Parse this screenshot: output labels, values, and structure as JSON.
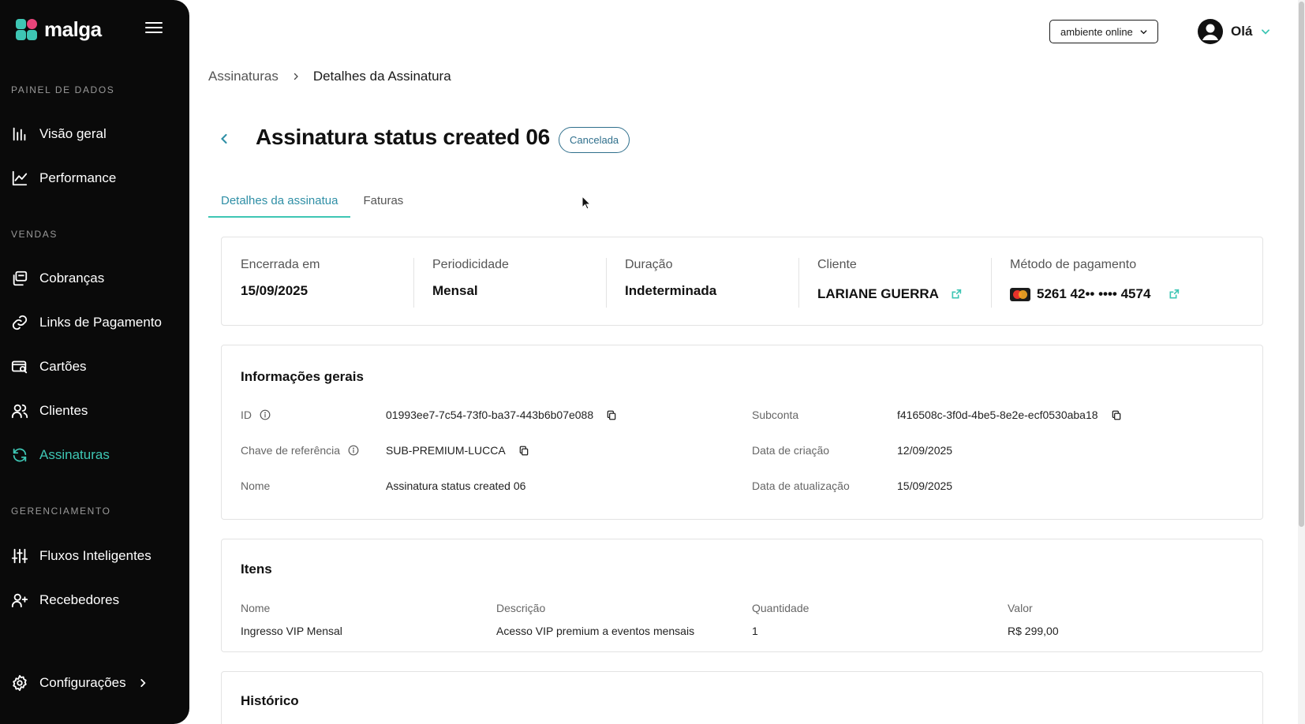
{
  "app": {
    "logo_text": "malga"
  },
  "sidebar": {
    "sections": {
      "dados": "PAINEL DE DADOS",
      "vendas": "VENDAS",
      "gerenciamento": "GERENCIAMENTO"
    },
    "items": {
      "visao_geral": {
        "label": "Visão geral",
        "icon": "bar-chart-icon"
      },
      "performance": {
        "label": "Performance",
        "icon": "line-chart-icon"
      },
      "cobrancas": {
        "label": "Cobranças",
        "icon": "charges-icon"
      },
      "links": {
        "label": "Links de Pagamento",
        "icon": "link-icon"
      },
      "cartoes": {
        "label": "Cartões",
        "icon": "card-search-icon"
      },
      "clientes": {
        "label": "Clientes",
        "icon": "users-icon"
      },
      "assinaturas": {
        "label": "Assinaturas",
        "icon": "refresh-icon",
        "active": true
      },
      "fluxos": {
        "label": "Fluxos Inteligentes",
        "icon": "sliders-icon"
      },
      "recebedores": {
        "label": "Recebedores",
        "icon": "user-plus-icon"
      },
      "configuracoes": {
        "label": "Configurações",
        "icon": "gear-icon"
      }
    }
  },
  "topbar": {
    "environment": "ambiente online",
    "greeting": "Olá"
  },
  "breadcrumb": {
    "parent": "Assinaturas",
    "current": "Detalhes da Assinatura"
  },
  "page": {
    "title": "Assinatura status created 06",
    "status": "Cancelada"
  },
  "tabs": {
    "details": "Detalhes da assinatua",
    "invoices": "Faturas"
  },
  "summary": {
    "ended": {
      "label": "Encerrada em",
      "value": "15/09/2025"
    },
    "period": {
      "label": "Periodicidade",
      "value": "Mensal"
    },
    "duration": {
      "label": "Duração",
      "value": "Indeterminada"
    },
    "customer": {
      "label": "Cliente",
      "value": "LARIANE GUERRA"
    },
    "payment": {
      "label": "Método de pagamento",
      "value": "5261 42•• •••• 4574"
    }
  },
  "info": {
    "title": "Informações gerais",
    "id": {
      "label": "ID",
      "value": "01993ee7-7c54-73f0-ba37-443b6b07e088"
    },
    "reference": {
      "label": "Chave de referência",
      "value": "SUB-PREMIUM-LUCCA"
    },
    "name": {
      "label": "Nome",
      "value": "Assinatura status created 06"
    },
    "subaccount": {
      "label": "Subconta",
      "value": "f416508c-3f0d-4be5-8e2e-ecf0530aba18"
    },
    "created": {
      "label": "Data de criação",
      "value": "12/09/2025"
    },
    "updated": {
      "label": "Data de atualização",
      "value": "15/09/2025"
    }
  },
  "items": {
    "title": "Itens",
    "headers": {
      "name": "Nome",
      "description": "Descrição",
      "quantity": "Quantidade",
      "value": "Valor"
    },
    "rows": [
      {
        "name": "Ingresso VIP Mensal",
        "description": "Acesso VIP premium a eventos mensais",
        "quantity": "1",
        "value": "R$ 299,00"
      }
    ]
  },
  "history": {
    "title": "Histórico"
  },
  "colors": {
    "accent": "#3ec6b4",
    "sidebar_bg": "#0a0a0a",
    "badge": "#2f6f8c"
  }
}
